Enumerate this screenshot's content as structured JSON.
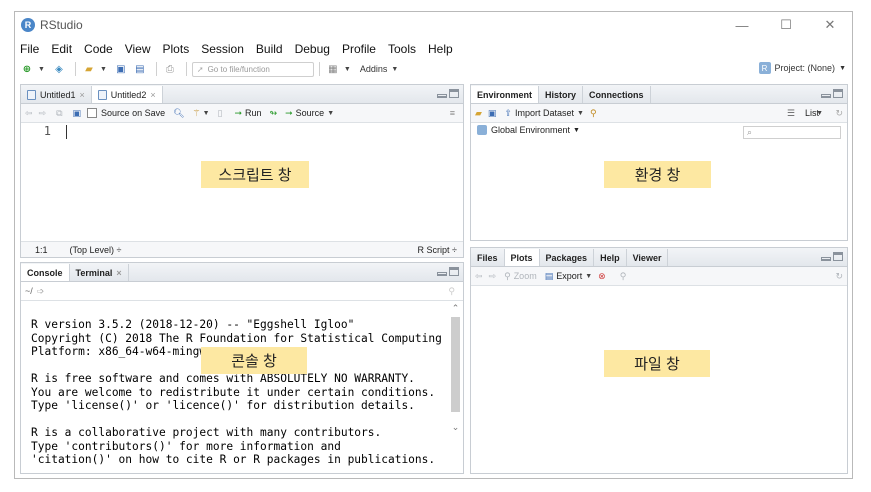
{
  "window": {
    "title": "RStudio",
    "app_icon": "R",
    "controls": [
      "—",
      "☐",
      "✕"
    ]
  },
  "menu": [
    "File",
    "Edit",
    "Code",
    "View",
    "Plots",
    "Session",
    "Build",
    "Debug",
    "Profile",
    "Tools",
    "Help"
  ],
  "toolbar": {
    "goto_placeholder": "Go to file/function",
    "addins_label": "Addins",
    "project_label": "Project: (None)"
  },
  "source_pane": {
    "tabs": [
      {
        "label": "Untitled1",
        "active": false
      },
      {
        "label": "Untitled2",
        "active": true
      }
    ],
    "source_on_save": "Source on Save",
    "run_label": "Run",
    "source_label": "Source",
    "line_number": "1",
    "status_position": "1:1",
    "status_scope": "(Top Level) ÷",
    "status_type": "R Script ÷",
    "overlay_label": "스크립트 창"
  },
  "environment_pane": {
    "tabs": [
      {
        "label": "Environment",
        "active": true
      },
      {
        "label": "History",
        "active": false
      },
      {
        "label": "Connections",
        "active": false
      }
    ],
    "import_dataset": "Import Dataset",
    "list_view": "List",
    "scope": "Global Environment",
    "overlay_label": "환경 창"
  },
  "console_pane": {
    "tabs": [
      {
        "label": "Console",
        "active": true
      },
      {
        "label": "Terminal",
        "active": false
      }
    ],
    "path": "~/",
    "text": "R version 3.5.2 (2018-12-20) -- \"Eggshell Igloo\"\nCopyright (C) 2018 The R Foundation for Statistical Computing\nPlatform: x86_64-w64-mingw\n\nR is free software and comes with ABSOLUTELY NO WARRANTY.\nYou are welcome to redistribute it under certain conditions.\nType 'license()' or 'licence()' for distribution details.\n\nR is a collaborative project with many contributors.\nType 'contributors()' for more information and\n'citation()' on how to cite R or R packages in publications.",
    "overlay_label": "콘솔 창"
  },
  "files_pane": {
    "tabs": [
      {
        "label": "Files",
        "active": false
      },
      {
        "label": "Plots",
        "active": true
      },
      {
        "label": "Packages",
        "active": false
      },
      {
        "label": "Help",
        "active": false
      },
      {
        "label": "Viewer",
        "active": false
      }
    ],
    "zoom_label": "Zoom",
    "export_label": "Export",
    "overlay_label": "파일 창"
  },
  "colors": {
    "overlay": "#fde8a2",
    "pane_border": "#c8cdd3",
    "accent": "#4a86c8"
  }
}
